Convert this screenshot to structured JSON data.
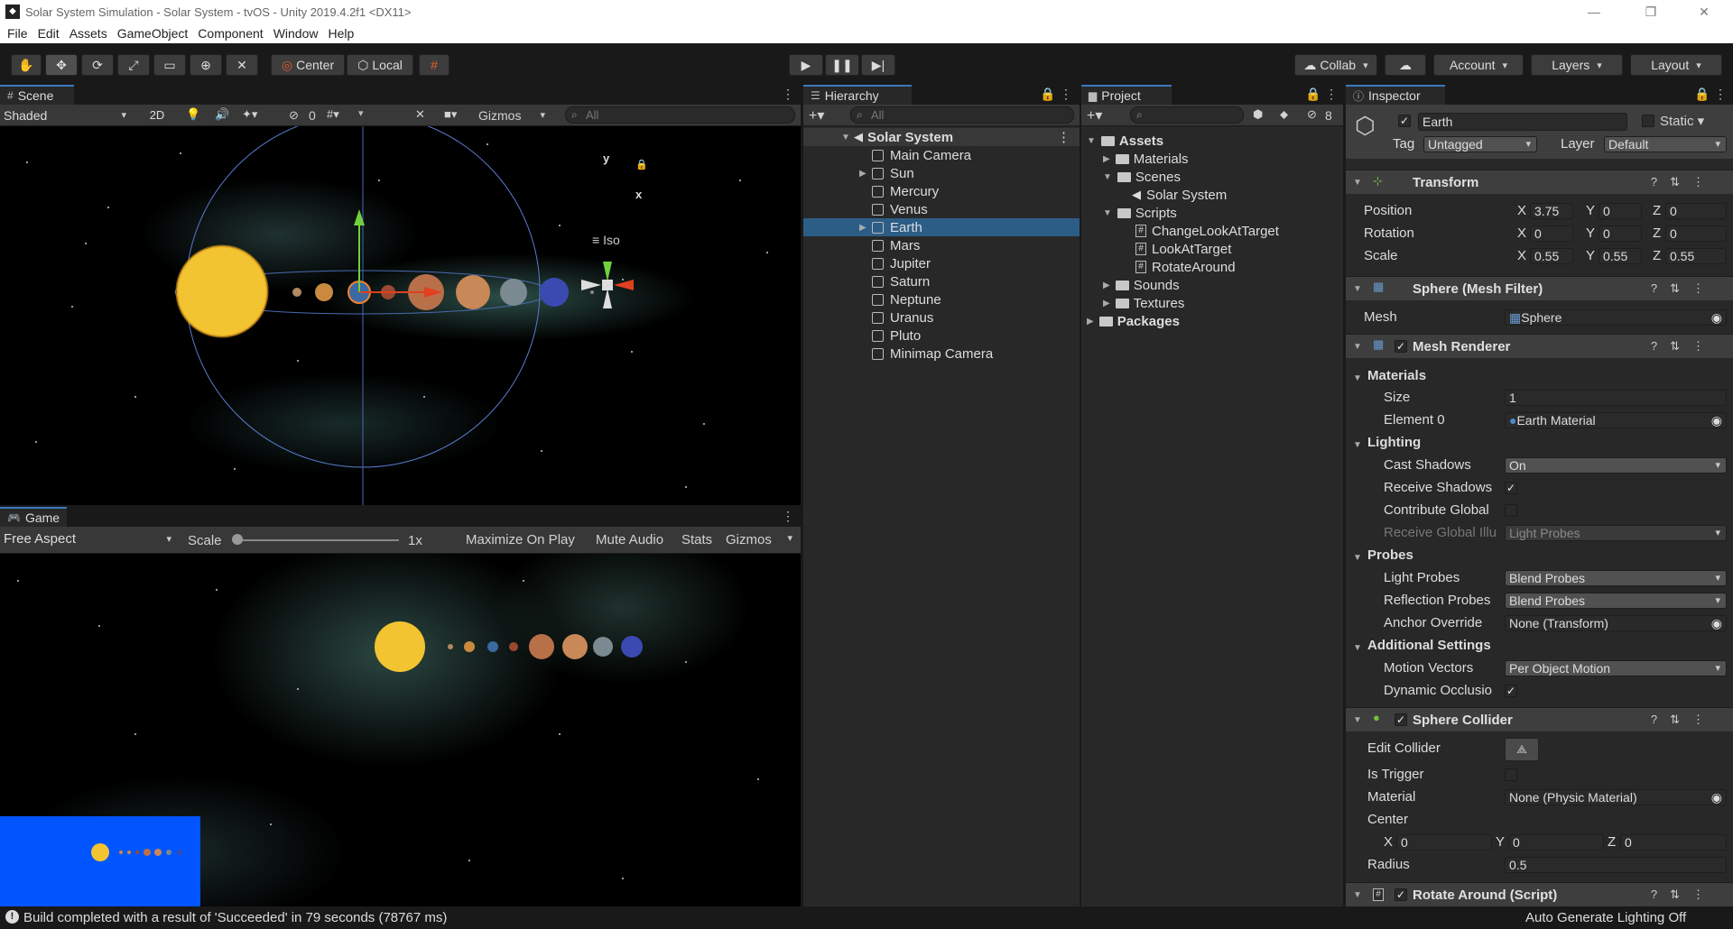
{
  "window": {
    "title": "Solar System Simulation - Solar System - tvOS - Unity 2019.4.2f1 <DX11>",
    "controls": {
      "minimize": "—",
      "restore": "❐",
      "close": "✕"
    }
  },
  "menu": [
    "File",
    "Edit",
    "Assets",
    "GameObject",
    "Component",
    "Window",
    "Help"
  ],
  "toolbar": {
    "tools": [
      "hand-tool",
      "move-tool",
      "rotate-tool",
      "scale-tool",
      "rect-tool",
      "transform-tool",
      "custom-tool"
    ],
    "pivot": "Center",
    "space": "Local",
    "collab": "Collab",
    "account": "Account",
    "layers": "Layers",
    "layout": "Layout"
  },
  "scene": {
    "tab": "Scene",
    "shading": "Shaded",
    "mode2d": "2D",
    "hidden_count": "0",
    "gizmos": "Gizmos",
    "search_placeholder": "All",
    "gizmo_y": "y",
    "gizmo_x": "x",
    "projection": "Iso"
  },
  "game": {
    "tab": "Game",
    "aspect": "Free Aspect",
    "scale_label": "Scale",
    "scale_value": "1x",
    "maximize": "Maximize On Play",
    "mute": "Mute Audio",
    "stats": "Stats",
    "gizmos": "Gizmos"
  },
  "hierarchy": {
    "tab": "Hierarchy",
    "search_placeholder": "All",
    "root": "Solar System",
    "items": [
      "Main Camera",
      "Sun",
      "Mercury",
      "Venus",
      "Earth",
      "Mars",
      "Jupiter",
      "Saturn",
      "Neptune",
      "Uranus",
      "Pluto",
      "Minimap Camera"
    ],
    "selected": "Earth"
  },
  "project": {
    "tab": "Project",
    "hidden_count": "8",
    "tree": {
      "assets": "Assets",
      "materials": "Materials",
      "scenes": "Scenes",
      "scene_file": "Solar System",
      "scripts": "Scripts",
      "script1": "ChangeLookAtTarget",
      "script2": "LookAtTarget",
      "script3": "RotateAround",
      "sounds": "Sounds",
      "textures": "Textures",
      "packages": "Packages"
    }
  },
  "inspector": {
    "tab": "Inspector",
    "object_name": "Earth",
    "static": "Static",
    "tag_label": "Tag",
    "tag": "Untagged",
    "layer_label": "Layer",
    "layer": "Default",
    "transform": {
      "title": "Transform",
      "position_label": "Position",
      "position": {
        "x": "3.75",
        "y": "0",
        "z": "0"
      },
      "rotation_label": "Rotation",
      "rotation": {
        "x": "0",
        "y": "0",
        "z": "0"
      },
      "scale_label": "Scale",
      "scale": {
        "x": "0.55",
        "y": "0.55",
        "z": "0.55"
      },
      "axis_x": "X",
      "axis_y": "Y",
      "axis_z": "Z"
    },
    "mesh_filter": {
      "title": "Sphere (Mesh Filter)",
      "mesh_label": "Mesh",
      "mesh": "Sphere"
    },
    "mesh_renderer": {
      "title": "Mesh Renderer",
      "materials": "Materials",
      "size_label": "Size",
      "size": "1",
      "element0_label": "Element 0",
      "element0": "Earth Material",
      "lighting": "Lighting",
      "cast_shadows_label": "Cast Shadows",
      "cast_shadows": "On",
      "receive_shadows_label": "Receive Shadows",
      "contribute_gi_label": "Contribute Global",
      "receive_gi_label": "Receive Global Illu",
      "receive_gi": "Light Probes",
      "probes": "Probes",
      "light_probes_label": "Light Probes",
      "light_probes": "Blend Probes",
      "reflection_probes_label": "Reflection Probes",
      "reflection_probes": "Blend Probes",
      "anchor_override_label": "Anchor Override",
      "anchor_override": "None (Transform)",
      "additional_settings": "Additional Settings",
      "motion_vectors_label": "Motion Vectors",
      "motion_vectors": "Per Object Motion",
      "dynamic_occlusion_label": "Dynamic Occlusio"
    },
    "sphere_collider": {
      "title": "Sphere Collider",
      "edit_collider_label": "Edit Collider",
      "is_trigger_label": "Is Trigger",
      "material_label": "Material",
      "material": "None (Physic Material)",
      "center_label": "Center",
      "center": {
        "x": "0",
        "y": "0",
        "z": "0"
      },
      "radius_label": "Radius",
      "radius": "0.5"
    },
    "rotate_around": {
      "title": "Rotate Around (Script)"
    }
  },
  "status": {
    "message": "Build completed with a result of 'Succeeded' in 79 seconds (78767 ms)",
    "lighting": "Auto Generate Lighting Off"
  },
  "colors": {
    "accent": "#3a79bb",
    "selection": "#2c5d87",
    "panel": "#282828",
    "minimap": "#0055ff"
  }
}
